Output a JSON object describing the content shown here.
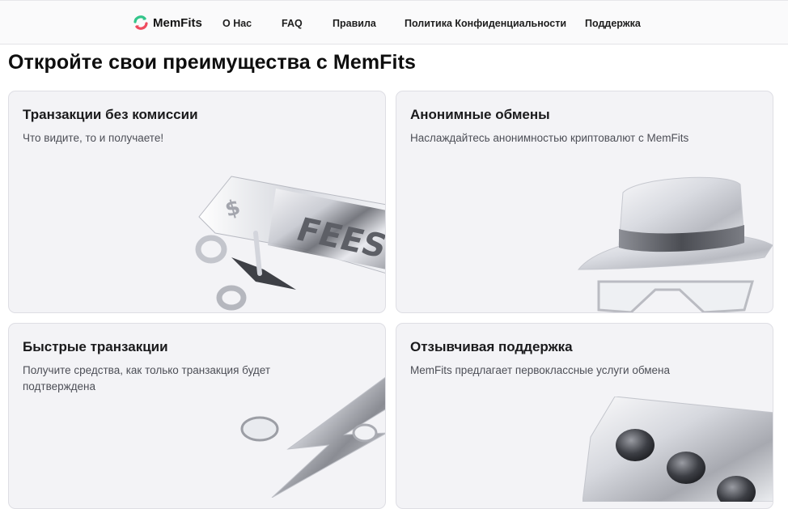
{
  "header": {
    "brand": "MemFits",
    "nav": [
      {
        "label": "О Нас"
      },
      {
        "label": "FAQ"
      },
      {
        "label": "Правила"
      },
      {
        "label": "Политика Конфиденциальности"
      },
      {
        "label": "Поддержка"
      }
    ]
  },
  "main": {
    "title": "Откройте свои преимущества с MemFits",
    "cards": [
      {
        "title": "Транзакции без комиссии",
        "description": "Что видите, то и получаете!",
        "art_text": "FEES",
        "art_symbol": "$"
      },
      {
        "title": "Анонимные обмены",
        "description": "Наслаждайтесь анонимностью криптовалют с MemFits"
      },
      {
        "title": "Быстрые транзакции",
        "description": "Получите средства, как только транзакция будет подтверждена"
      },
      {
        "title": "Отзывчивая поддержка",
        "description": "MemFits предлагает первоклассные услуги обмена"
      }
    ]
  },
  "colors": {
    "logo_green": "#33c58a",
    "logo_red": "#ef4b5f",
    "card_bg": "#f3f3f6"
  },
  "icons": [
    "memfits-logo-icon",
    "fees-tag-3d-illustration",
    "hat-glasses-3d-illustration",
    "lightning-3d-illustration",
    "chat-bubble-3d-illustration"
  ]
}
